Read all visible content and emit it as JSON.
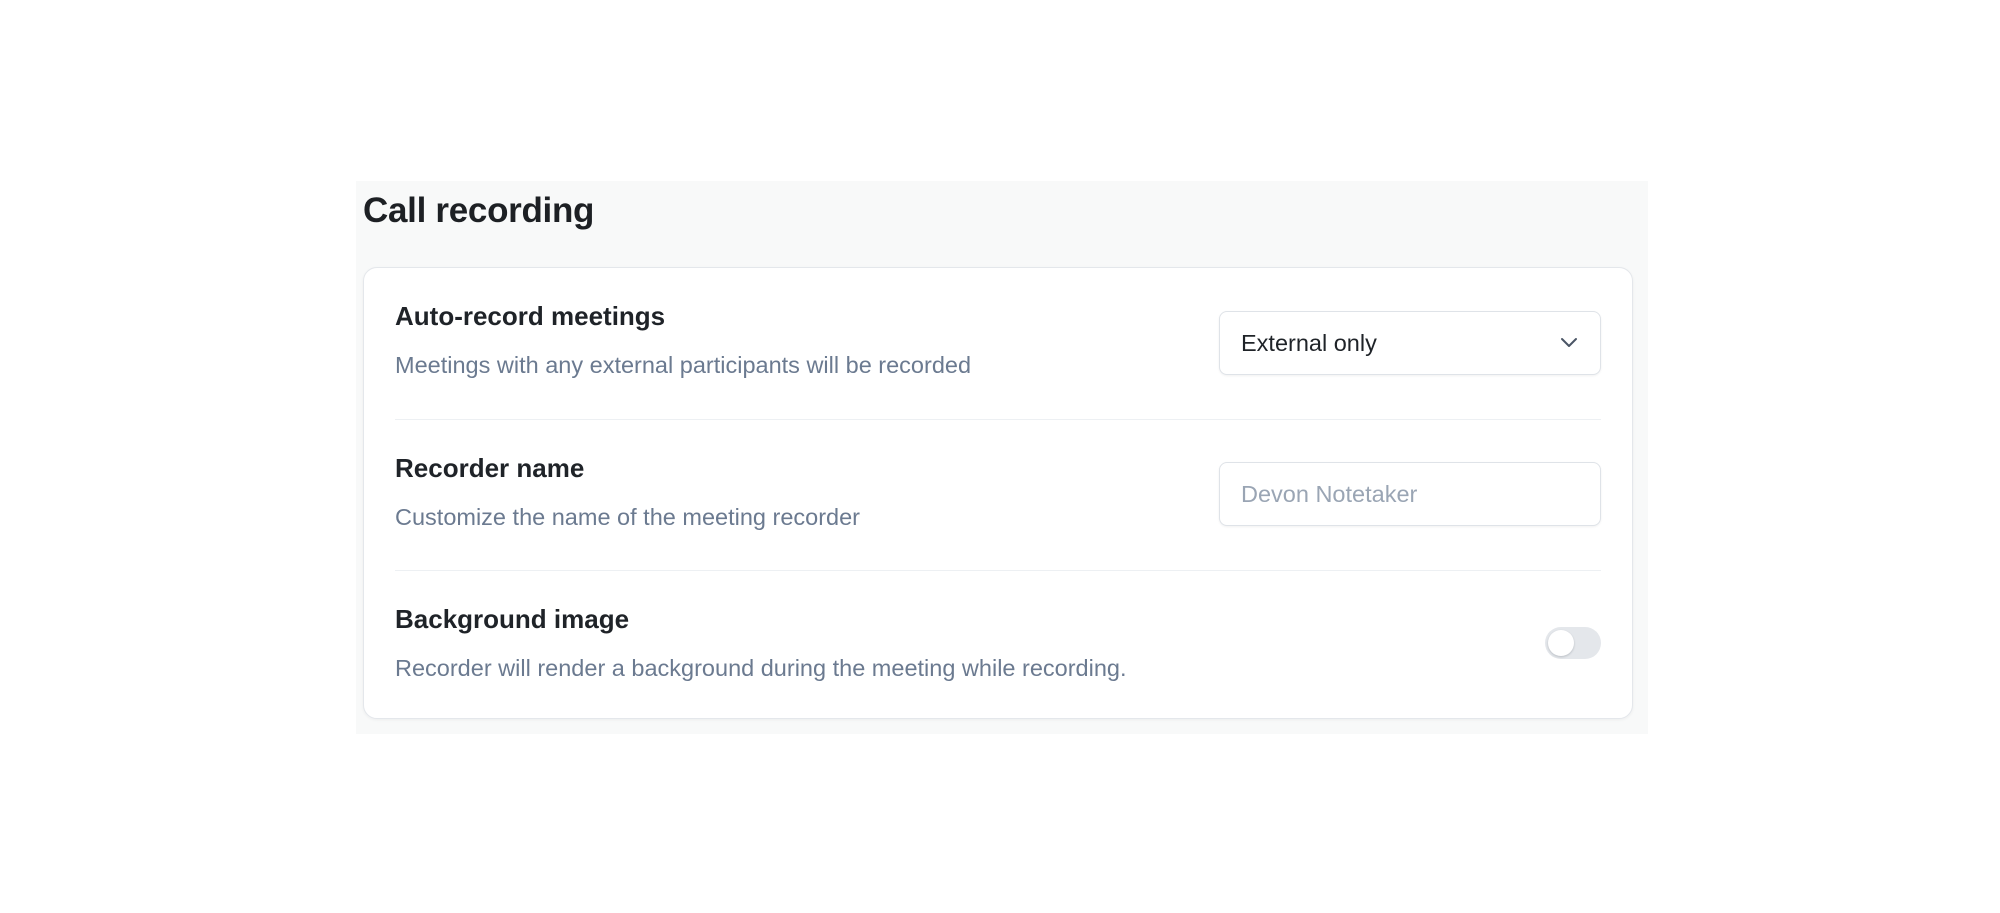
{
  "section": {
    "title": "Call recording"
  },
  "settings": {
    "auto_record": {
      "label": "Auto-record meetings",
      "description": "Meetings with any external participants will be recorded",
      "selected_value": "External only",
      "icon": "chevron-down-icon"
    },
    "recorder_name": {
      "label": "Recorder name",
      "description": "Customize the name of the meeting recorder",
      "value": "",
      "placeholder": "Devon Notetaker"
    },
    "background_image": {
      "label": "Background image",
      "description": "Recorder will render a background during the meeting while recording.",
      "enabled": false
    }
  },
  "colors": {
    "panel_background": "#f8f9f9",
    "card_background": "#ffffff",
    "title_text": "#1d2024",
    "description_text": "#6b7a90",
    "placeholder_text": "#9aa5b4",
    "toggle_off": "#e4e7eb",
    "border": "#dfe3e8"
  }
}
